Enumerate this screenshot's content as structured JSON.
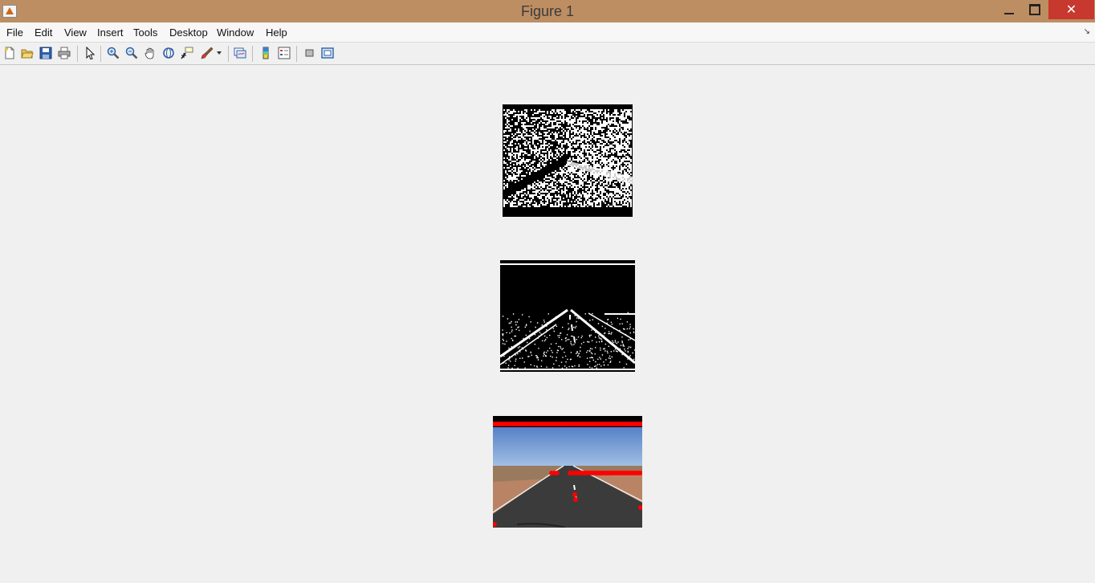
{
  "window": {
    "title": "Figure 1",
    "icon": "matlab-icon",
    "controls": {
      "minimize": "minimize-icon",
      "maximize": "maximize-icon",
      "close": "✕"
    }
  },
  "menu": {
    "items": [
      "File",
      "Edit",
      "View",
      "Insert",
      "Tools",
      "Desktop",
      "Window",
      "Help"
    ]
  },
  "toolbar": {
    "tools": [
      "new-figure-icon",
      "open-icon",
      "save-icon",
      "print-icon",
      "edit-plot-icon",
      "zoom-in-icon",
      "zoom-out-icon",
      "pan-icon",
      "rotate-3d-icon",
      "data-cursor-icon",
      "brush-icon",
      "link-plot-icon",
      "colorbar-icon",
      "legend-icon",
      "hide-plot-tools-icon",
      "show-plot-tools-icon"
    ]
  },
  "figure": {
    "panels": [
      "noise-binary-image",
      "edge-binary-road-image",
      "road-photo-with-red-markers"
    ],
    "marker_color": "#ff0000",
    "background": "#f0f0f0"
  }
}
